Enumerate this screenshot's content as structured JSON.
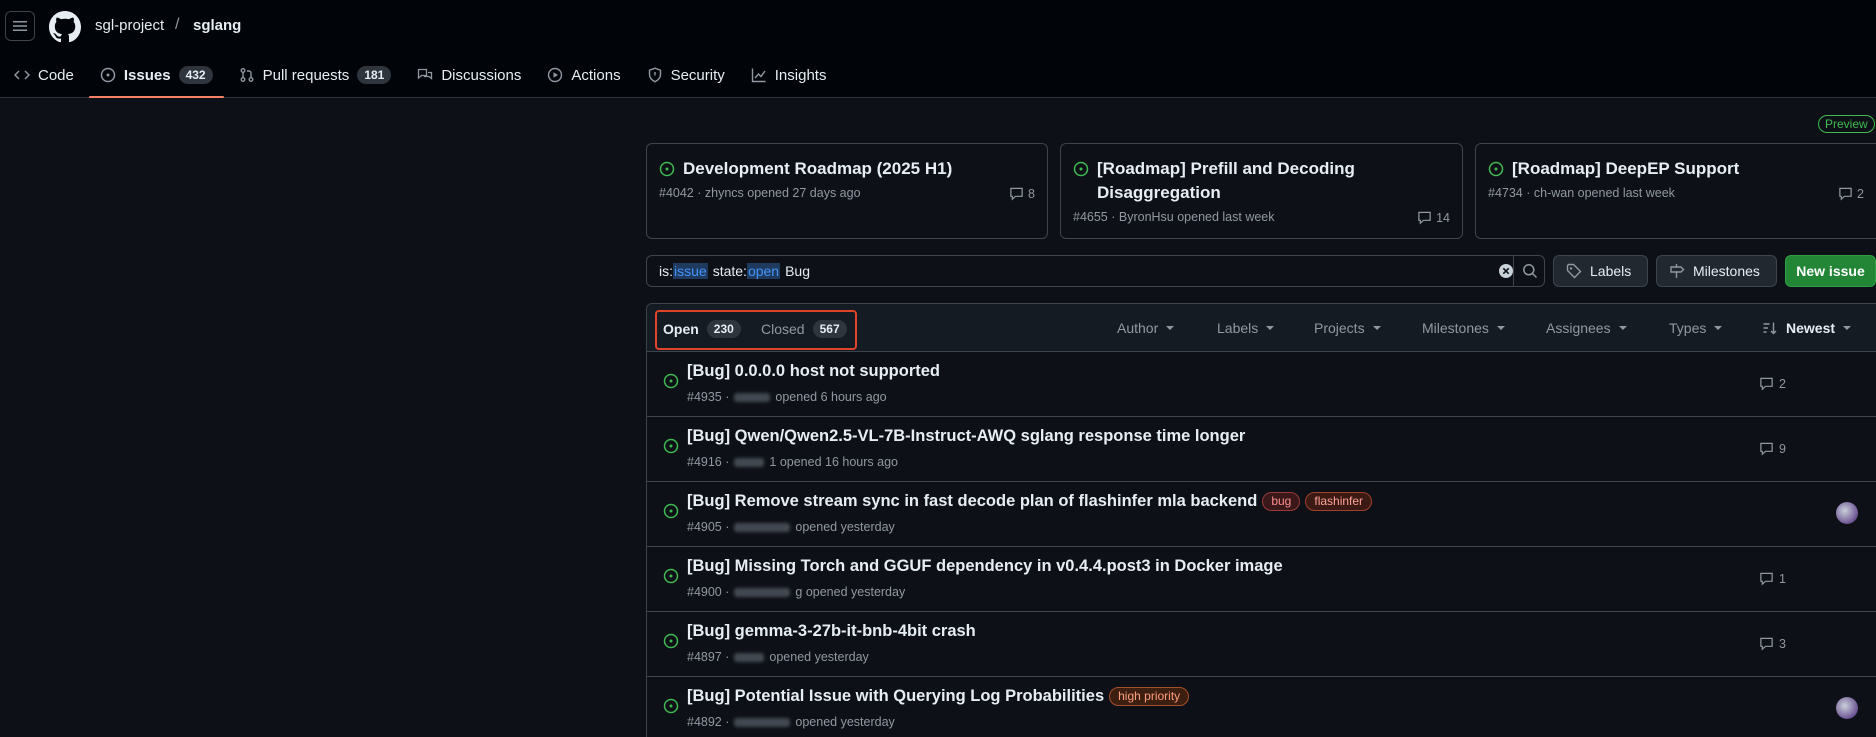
{
  "repo": {
    "owner": "sgl-project",
    "separator": "/",
    "name": "sglang"
  },
  "tabs": [
    {
      "label": "Code"
    },
    {
      "label": "Issues",
      "count": "432"
    },
    {
      "label": "Pull requests",
      "count": "181"
    },
    {
      "label": "Discussions"
    },
    {
      "label": "Actions"
    },
    {
      "label": "Security"
    },
    {
      "label": "Insights"
    }
  ],
  "preview_badge": "Preview",
  "pinned": [
    {
      "title": "Development Roadmap (2025 H1)",
      "meta": "#4042 · zhyncs opened 27 days ago",
      "comments": "8"
    },
    {
      "title": "[Roadmap] Prefill and Decoding Disaggregation",
      "meta": "#4655 · ByronHsu opened last week",
      "comments": "14"
    },
    {
      "title": "[Roadmap] DeepEP Support",
      "meta": "#4734 · ch-wan opened last week",
      "comments": "2"
    }
  ],
  "search": {
    "q1_key": "is:",
    "q1_val": "issue",
    "q2_key": "state:",
    "q2_val": "open",
    "q3": "Bug"
  },
  "buttons": {
    "labels": "Labels",
    "milestones": "Milestones",
    "new_issue": "New issue"
  },
  "state": {
    "open_label": "Open",
    "open_count": "230",
    "closed_label": "Closed",
    "closed_count": "567"
  },
  "filters": [
    "Author",
    "Labels",
    "Projects",
    "Milestones",
    "Assignees",
    "Types",
    "Newest"
  ],
  "issues": [
    {
      "title": "[Bug] 0.0.0.0 host not supported",
      "number": "#4935 ·",
      "opened": "opened 6 hours ago",
      "comments": "2"
    },
    {
      "title": "[Bug] Qwen/Qwen2.5-VL-7B-Instruct-AWQ sglang response time longer",
      "number": "#4916 ·",
      "opened": "1 opened 16 hours ago",
      "comments": "9"
    },
    {
      "title": "[Bug] Remove stream sync in fast decode plan of flashinfer mla backend",
      "number": "#4905 ·",
      "opened": "opened yesterday",
      "labels": [
        "bug",
        "flashinfer"
      ]
    },
    {
      "title": "[Bug] Missing Torch and GGUF dependency in v0.4.4.post3 in Docker image",
      "number": "#4900 ·",
      "opened": "g opened yesterday",
      "comments": "1"
    },
    {
      "title": "[Bug] gemma-3-27b-it-bnb-4bit crash",
      "number": "#4897 ·",
      "opened": "opened yesterday",
      "comments": "3"
    },
    {
      "title": "[Bug] Potential Issue with Querying Log Probabilities",
      "number": "#4892 ·",
      "opened": "opened yesterday",
      "labels": [
        "high priority"
      ]
    }
  ]
}
